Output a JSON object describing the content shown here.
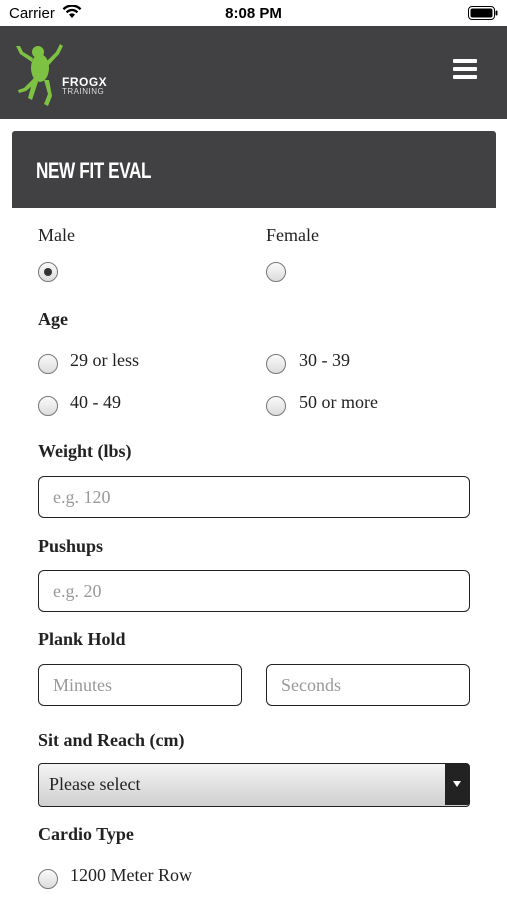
{
  "status_bar": {
    "carrier": "Carrier",
    "time": "8:08 PM"
  },
  "header": {
    "logo_text": "FROGX",
    "logo_subtext": "TRAINING"
  },
  "card": {
    "title": "NEW FIT EVAL"
  },
  "gender": {
    "male": "Male",
    "female": "Female",
    "selected": "Male"
  },
  "age": {
    "label": "Age",
    "options": [
      "29 or less",
      "30 - 39",
      "40 - 49",
      "50 or more"
    ]
  },
  "weight": {
    "label": "Weight (lbs)",
    "placeholder": "e.g. 120",
    "value": ""
  },
  "pushups": {
    "label": "Pushups",
    "placeholder": "e.g. 20",
    "value": ""
  },
  "plank": {
    "label": "Plank Hold",
    "minutes_placeholder": "Minutes",
    "seconds_placeholder": "Seconds"
  },
  "sit_reach": {
    "label": "Sit and Reach (cm)",
    "selected": "Please select"
  },
  "cardio": {
    "label": "Cardio Type",
    "options": [
      "1200 Meter Row"
    ]
  },
  "colors": {
    "header_bg": "#414042",
    "logo_green": "#7dc242"
  }
}
